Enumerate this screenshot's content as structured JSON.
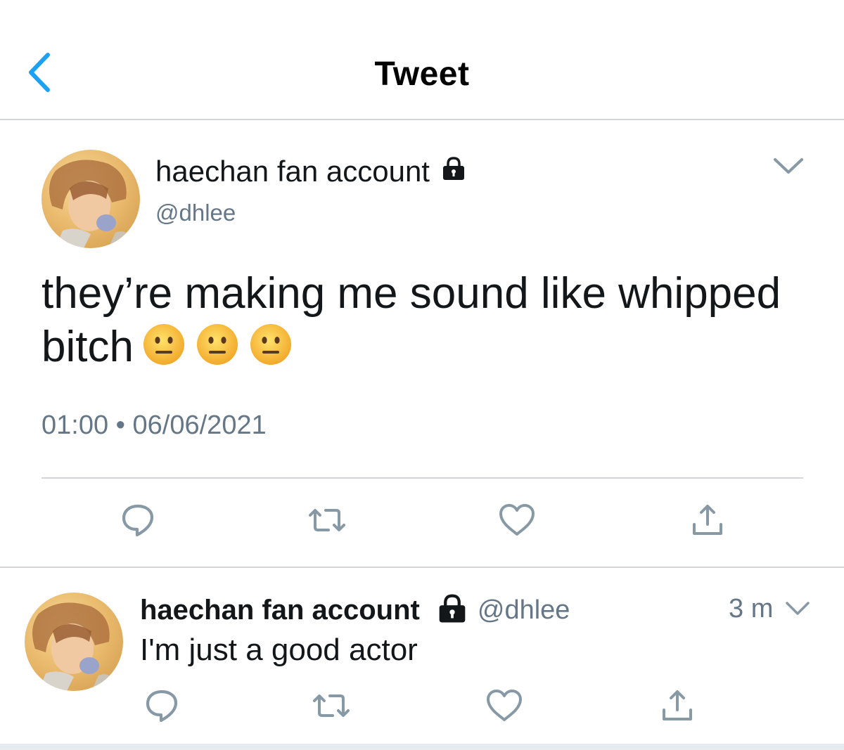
{
  "header": {
    "title": "Tweet",
    "back_icon": "chevron-left-icon",
    "accent_color": "#1da1f2"
  },
  "main_tweet": {
    "display_name": "haechan fan account",
    "handle": "@dhlee",
    "protected_icon": "lock-icon",
    "text": "they’re making me sound like whipped bitch",
    "emojis": [
      "neutral-face-emoji",
      "neutral-face-emoji",
      "neutral-face-emoji"
    ],
    "time": "01:00",
    "separator": "•",
    "date": "06/06/2021",
    "menu_icon": "chevron-down-icon",
    "actions": [
      "reply-icon",
      "retweet-icon",
      "like-icon",
      "share-icon"
    ]
  },
  "reply_tweet": {
    "display_name": "haechan fan account",
    "handle": "@dhlee",
    "protected_icon": "lock-icon",
    "time_ago": "3 m",
    "text": "I'm just a good actor",
    "menu_icon": "chevron-down-icon",
    "actions": [
      "reply-icon",
      "retweet-icon",
      "like-icon",
      "share-icon"
    ]
  },
  "colors": {
    "text_primary": "#14171a",
    "text_secondary": "#657786",
    "icon_gray": "#8899a6",
    "divider": "#d3d6d9"
  }
}
